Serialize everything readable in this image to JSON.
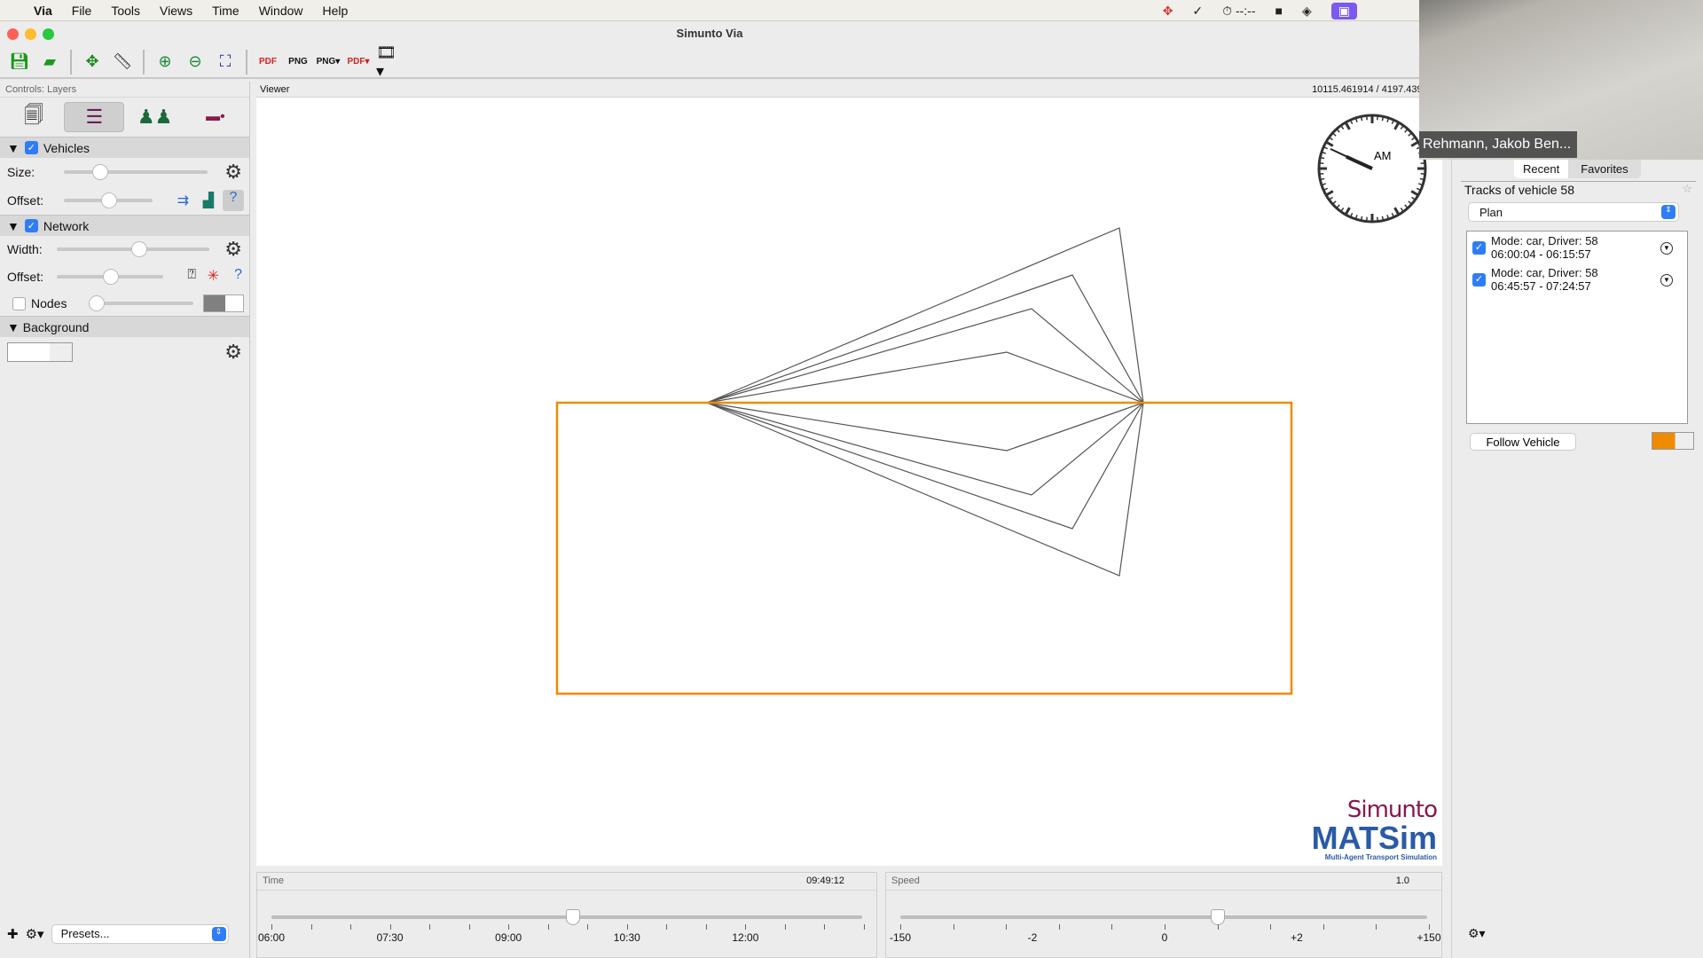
{
  "menubar": {
    "app": "Via",
    "items": [
      "File",
      "Tools",
      "Views",
      "Time",
      "Window",
      "Help"
    ],
    "tray_clock": "--:--"
  },
  "window": {
    "title": "Simunto Via"
  },
  "toolbar": {
    "icons": [
      "save-icon",
      "open-folder-icon",
      "move-icon",
      "ruler-icon",
      "zoom-in-icon",
      "zoom-out-icon",
      "zoom-fit-icon",
      "export-pdf-icon",
      "export-png-icon",
      "export-png-series-icon",
      "export-png-pdf-icon",
      "record-movie-icon"
    ]
  },
  "controls": {
    "title": "Controls: Layers",
    "vehicles": {
      "label": "Vehicles",
      "checked": true,
      "size_label": "Size:",
      "offset_label": "Offset:"
    },
    "network": {
      "label": "Network",
      "checked": true,
      "width_label": "Width:",
      "offset_label": "Offset:",
      "nodes_label": "Nodes",
      "nodes_checked": false,
      "node_color": "#808080"
    },
    "background": {
      "label": "Background",
      "color": "#ffffff"
    },
    "presets": "Presets..."
  },
  "viewer": {
    "title": "Viewer",
    "coords": "10115.461914 / 4197.439941",
    "clock_label": "AM",
    "link_color": "#555555",
    "selected_color": "#f08a00",
    "logo": {
      "brand": "Simunto",
      "product": "MATSim",
      "tagline": "Multi-Agent Transport Simulation"
    }
  },
  "time": {
    "title": "Time",
    "value": "09:49:12",
    "ticks": [
      "06:00",
      "07:30",
      "09:00",
      "10:30",
      "12:00"
    ]
  },
  "speed": {
    "title": "Speed",
    "value": "1.0",
    "ticks": [
      "-150",
      "-2",
      "0",
      "+2",
      "+150"
    ]
  },
  "webcam": {
    "name": "Rehmann, Jakob Ben..."
  },
  "right": {
    "tabs": [
      "Recent",
      "Favorites"
    ],
    "active_tab": "Recent",
    "title": "Tracks of vehicle 58",
    "plan_select": "Plan",
    "tracks": [
      {
        "line1": "Mode: car, Driver: 58",
        "line2": "06:00:04 - 06:15:57",
        "checked": true
      },
      {
        "line1": "Mode: car, Driver: 58",
        "line2": "06:45:57 - 07:24:57",
        "checked": true
      }
    ],
    "follow": "Follow Vehicle",
    "track_color": "#f08a00"
  }
}
